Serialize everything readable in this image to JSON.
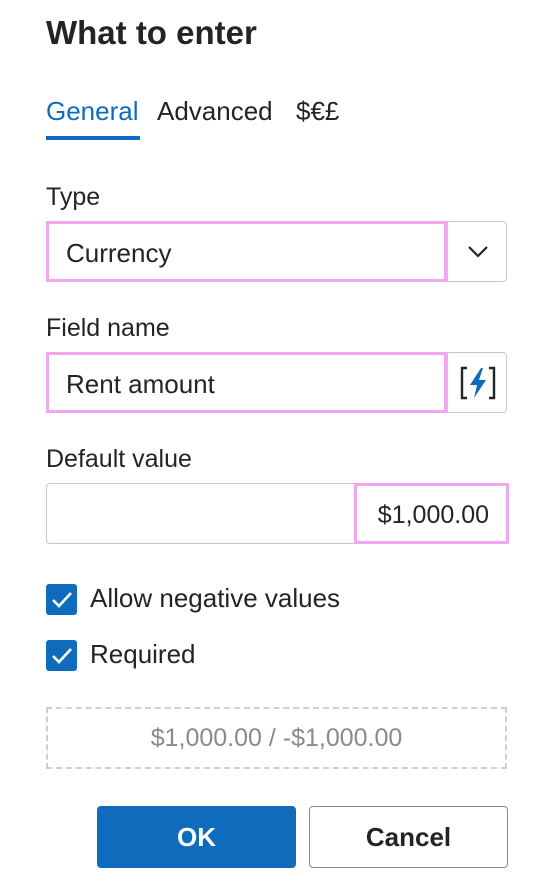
{
  "dialog": {
    "title": "What to enter"
  },
  "tabs": [
    {
      "label": "General",
      "active": true
    },
    {
      "label": "Advanced",
      "active": false
    },
    {
      "label": "$€£",
      "active": false
    }
  ],
  "type_field": {
    "label": "Type",
    "value": "Currency",
    "icon": "chevron-down-icon"
  },
  "name_field": {
    "label": "Field name",
    "value": "Rent amount",
    "icon": "lightning-bracket-icon"
  },
  "default_field": {
    "label": "Default value",
    "value": "$1,000.00"
  },
  "options": [
    {
      "label": "Allow negative values",
      "checked": true
    },
    {
      "label": "Required",
      "checked": true
    }
  ],
  "preview": {
    "text": "$1,000.00 / -$1,000.00"
  },
  "buttons": {
    "ok": "OK",
    "cancel": "Cancel"
  },
  "colors": {
    "accent": "#0f6cbd",
    "highlight": "#f0a6f0",
    "border": "#c8c8c8"
  }
}
